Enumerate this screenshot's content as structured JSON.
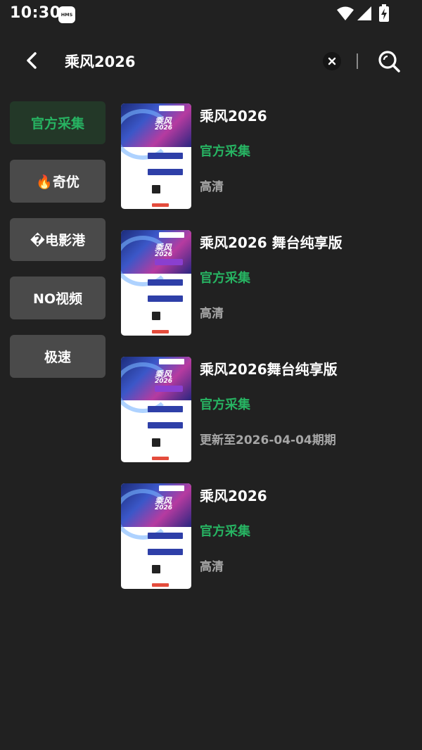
{
  "status_bar": {
    "time": "10:30",
    "badge": "HMS"
  },
  "search": {
    "query": "乘风2026"
  },
  "sources": [
    {
      "label": "官方采集",
      "active": true
    },
    {
      "label": "🔥奇优",
      "active": false
    },
    {
      "label": "�电影港",
      "active": false
    },
    {
      "label": "NO视频",
      "active": false
    },
    {
      "label": "极速",
      "active": false
    }
  ],
  "results": [
    {
      "title": "乘风2026",
      "source": "官方采集",
      "quality": "高清",
      "poster_title": "乘风",
      "poster_sub": "2026"
    },
    {
      "title": "乘风2026 舞台纯享版",
      "source": "官方采集",
      "quality": "高清",
      "poster_title": "乘风",
      "poster_sub": "2026"
    },
    {
      "title": "乘风2026舞台纯享版",
      "source": "官方采集",
      "quality": "更新至2026-04-04期期",
      "poster_title": "乘风",
      "poster_sub": "2026"
    },
    {
      "title": "乘风2026",
      "source": "官方采集",
      "quality": "高清",
      "poster_title": "乘风",
      "poster_sub": "2026"
    }
  ],
  "colors": {
    "background": "#212121",
    "accent_green": "#27b362",
    "active_source_bg": "#233828",
    "source_bg": "#4a4a4a",
    "quality_text": "#a6a6a6"
  }
}
